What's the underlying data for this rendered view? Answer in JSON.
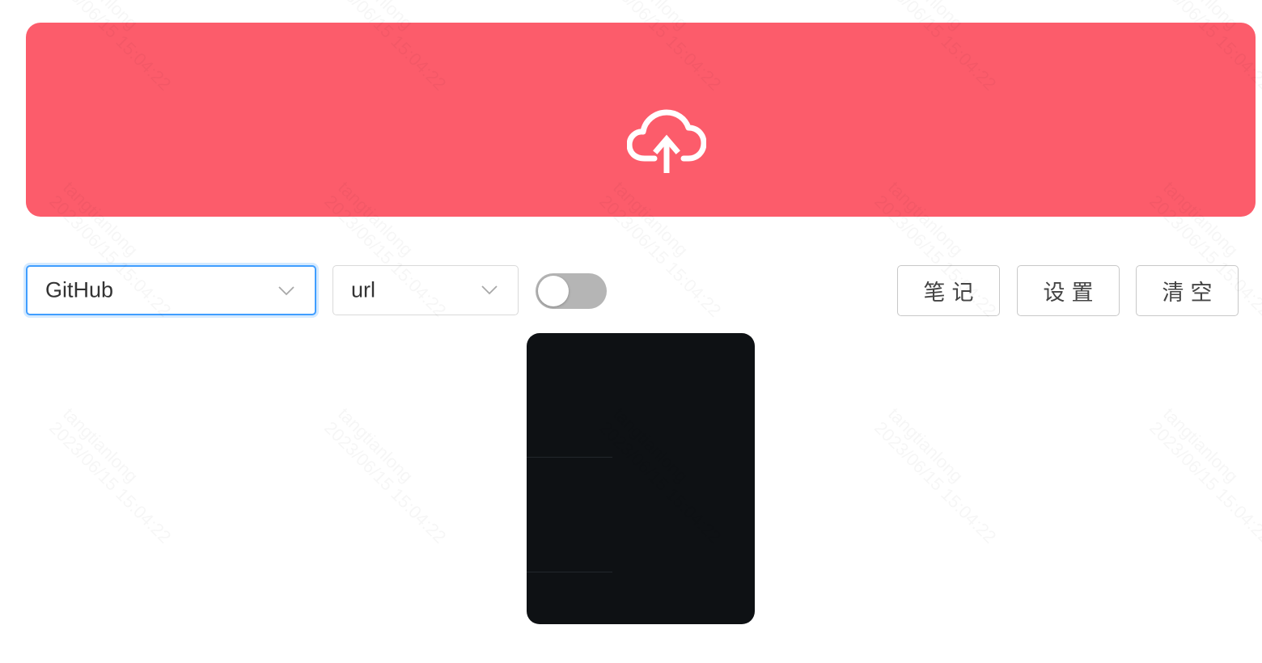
{
  "upload": {
    "icon": "cloud-upload-icon",
    "background_color": "#fc5c6b"
  },
  "controls": {
    "source_select": {
      "value": "GitHub"
    },
    "format_select": {
      "value": "url"
    },
    "toggle": {
      "on": false
    },
    "buttons": {
      "notes": "笔记",
      "settings": "设置",
      "clear": "清空"
    }
  },
  "preview": {
    "background_color": "#0e1114"
  },
  "watermark": {
    "user": "tangtianlong",
    "timestamp": "2023/06/15 15:04:22"
  },
  "colors": {
    "accent": "#409eff",
    "upload": "#fc5c6b",
    "toggle_off": "#b5b5b5"
  }
}
